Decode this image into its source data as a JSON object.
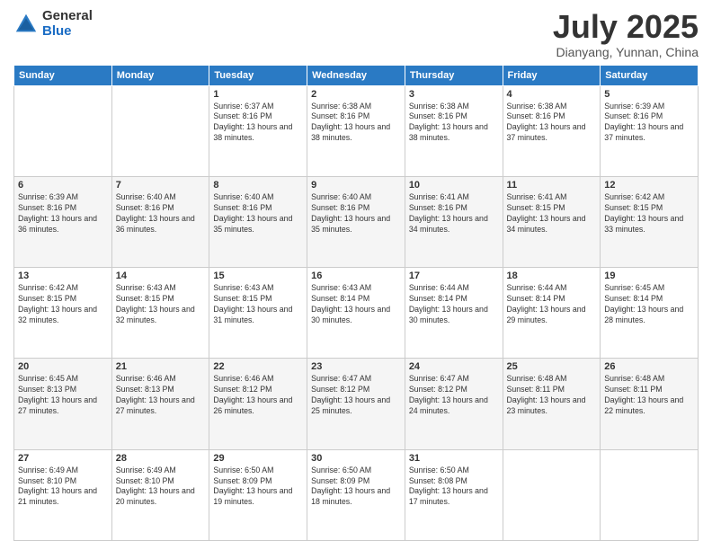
{
  "header": {
    "logo_general": "General",
    "logo_blue": "Blue",
    "title": "July 2025",
    "location": "Dianyang, Yunnan, China"
  },
  "weekdays": [
    "Sunday",
    "Monday",
    "Tuesday",
    "Wednesday",
    "Thursday",
    "Friday",
    "Saturday"
  ],
  "weeks": [
    [
      {
        "day": "",
        "sunrise": "",
        "sunset": "",
        "daylight": ""
      },
      {
        "day": "",
        "sunrise": "",
        "sunset": "",
        "daylight": ""
      },
      {
        "day": "1",
        "sunrise": "Sunrise: 6:37 AM",
        "sunset": "Sunset: 8:16 PM",
        "daylight": "Daylight: 13 hours and 38 minutes."
      },
      {
        "day": "2",
        "sunrise": "Sunrise: 6:38 AM",
        "sunset": "Sunset: 8:16 PM",
        "daylight": "Daylight: 13 hours and 38 minutes."
      },
      {
        "day": "3",
        "sunrise": "Sunrise: 6:38 AM",
        "sunset": "Sunset: 8:16 PM",
        "daylight": "Daylight: 13 hours and 38 minutes."
      },
      {
        "day": "4",
        "sunrise": "Sunrise: 6:38 AM",
        "sunset": "Sunset: 8:16 PM",
        "daylight": "Daylight: 13 hours and 37 minutes."
      },
      {
        "day": "5",
        "sunrise": "Sunrise: 6:39 AM",
        "sunset": "Sunset: 8:16 PM",
        "daylight": "Daylight: 13 hours and 37 minutes."
      }
    ],
    [
      {
        "day": "6",
        "sunrise": "Sunrise: 6:39 AM",
        "sunset": "Sunset: 8:16 PM",
        "daylight": "Daylight: 13 hours and 36 minutes."
      },
      {
        "day": "7",
        "sunrise": "Sunrise: 6:40 AM",
        "sunset": "Sunset: 8:16 PM",
        "daylight": "Daylight: 13 hours and 36 minutes."
      },
      {
        "day": "8",
        "sunrise": "Sunrise: 6:40 AM",
        "sunset": "Sunset: 8:16 PM",
        "daylight": "Daylight: 13 hours and 35 minutes."
      },
      {
        "day": "9",
        "sunrise": "Sunrise: 6:40 AM",
        "sunset": "Sunset: 8:16 PM",
        "daylight": "Daylight: 13 hours and 35 minutes."
      },
      {
        "day": "10",
        "sunrise": "Sunrise: 6:41 AM",
        "sunset": "Sunset: 8:16 PM",
        "daylight": "Daylight: 13 hours and 34 minutes."
      },
      {
        "day": "11",
        "sunrise": "Sunrise: 6:41 AM",
        "sunset": "Sunset: 8:15 PM",
        "daylight": "Daylight: 13 hours and 34 minutes."
      },
      {
        "day": "12",
        "sunrise": "Sunrise: 6:42 AM",
        "sunset": "Sunset: 8:15 PM",
        "daylight": "Daylight: 13 hours and 33 minutes."
      }
    ],
    [
      {
        "day": "13",
        "sunrise": "Sunrise: 6:42 AM",
        "sunset": "Sunset: 8:15 PM",
        "daylight": "Daylight: 13 hours and 32 minutes."
      },
      {
        "day": "14",
        "sunrise": "Sunrise: 6:43 AM",
        "sunset": "Sunset: 8:15 PM",
        "daylight": "Daylight: 13 hours and 32 minutes."
      },
      {
        "day": "15",
        "sunrise": "Sunrise: 6:43 AM",
        "sunset": "Sunset: 8:15 PM",
        "daylight": "Daylight: 13 hours and 31 minutes."
      },
      {
        "day": "16",
        "sunrise": "Sunrise: 6:43 AM",
        "sunset": "Sunset: 8:14 PM",
        "daylight": "Daylight: 13 hours and 30 minutes."
      },
      {
        "day": "17",
        "sunrise": "Sunrise: 6:44 AM",
        "sunset": "Sunset: 8:14 PM",
        "daylight": "Daylight: 13 hours and 30 minutes."
      },
      {
        "day": "18",
        "sunrise": "Sunrise: 6:44 AM",
        "sunset": "Sunset: 8:14 PM",
        "daylight": "Daylight: 13 hours and 29 minutes."
      },
      {
        "day": "19",
        "sunrise": "Sunrise: 6:45 AM",
        "sunset": "Sunset: 8:14 PM",
        "daylight": "Daylight: 13 hours and 28 minutes."
      }
    ],
    [
      {
        "day": "20",
        "sunrise": "Sunrise: 6:45 AM",
        "sunset": "Sunset: 8:13 PM",
        "daylight": "Daylight: 13 hours and 27 minutes."
      },
      {
        "day": "21",
        "sunrise": "Sunrise: 6:46 AM",
        "sunset": "Sunset: 8:13 PM",
        "daylight": "Daylight: 13 hours and 27 minutes."
      },
      {
        "day": "22",
        "sunrise": "Sunrise: 6:46 AM",
        "sunset": "Sunset: 8:12 PM",
        "daylight": "Daylight: 13 hours and 26 minutes."
      },
      {
        "day": "23",
        "sunrise": "Sunrise: 6:47 AM",
        "sunset": "Sunset: 8:12 PM",
        "daylight": "Daylight: 13 hours and 25 minutes."
      },
      {
        "day": "24",
        "sunrise": "Sunrise: 6:47 AM",
        "sunset": "Sunset: 8:12 PM",
        "daylight": "Daylight: 13 hours and 24 minutes."
      },
      {
        "day": "25",
        "sunrise": "Sunrise: 6:48 AM",
        "sunset": "Sunset: 8:11 PM",
        "daylight": "Daylight: 13 hours and 23 minutes."
      },
      {
        "day": "26",
        "sunrise": "Sunrise: 6:48 AM",
        "sunset": "Sunset: 8:11 PM",
        "daylight": "Daylight: 13 hours and 22 minutes."
      }
    ],
    [
      {
        "day": "27",
        "sunrise": "Sunrise: 6:49 AM",
        "sunset": "Sunset: 8:10 PM",
        "daylight": "Daylight: 13 hours and 21 minutes."
      },
      {
        "day": "28",
        "sunrise": "Sunrise: 6:49 AM",
        "sunset": "Sunset: 8:10 PM",
        "daylight": "Daylight: 13 hours and 20 minutes."
      },
      {
        "day": "29",
        "sunrise": "Sunrise: 6:50 AM",
        "sunset": "Sunset: 8:09 PM",
        "daylight": "Daylight: 13 hours and 19 minutes."
      },
      {
        "day": "30",
        "sunrise": "Sunrise: 6:50 AM",
        "sunset": "Sunset: 8:09 PM",
        "daylight": "Daylight: 13 hours and 18 minutes."
      },
      {
        "day": "31",
        "sunrise": "Sunrise: 6:50 AM",
        "sunset": "Sunset: 8:08 PM",
        "daylight": "Daylight: 13 hours and 17 minutes."
      },
      {
        "day": "",
        "sunrise": "",
        "sunset": "",
        "daylight": ""
      },
      {
        "day": "",
        "sunrise": "",
        "sunset": "",
        "daylight": ""
      }
    ]
  ]
}
